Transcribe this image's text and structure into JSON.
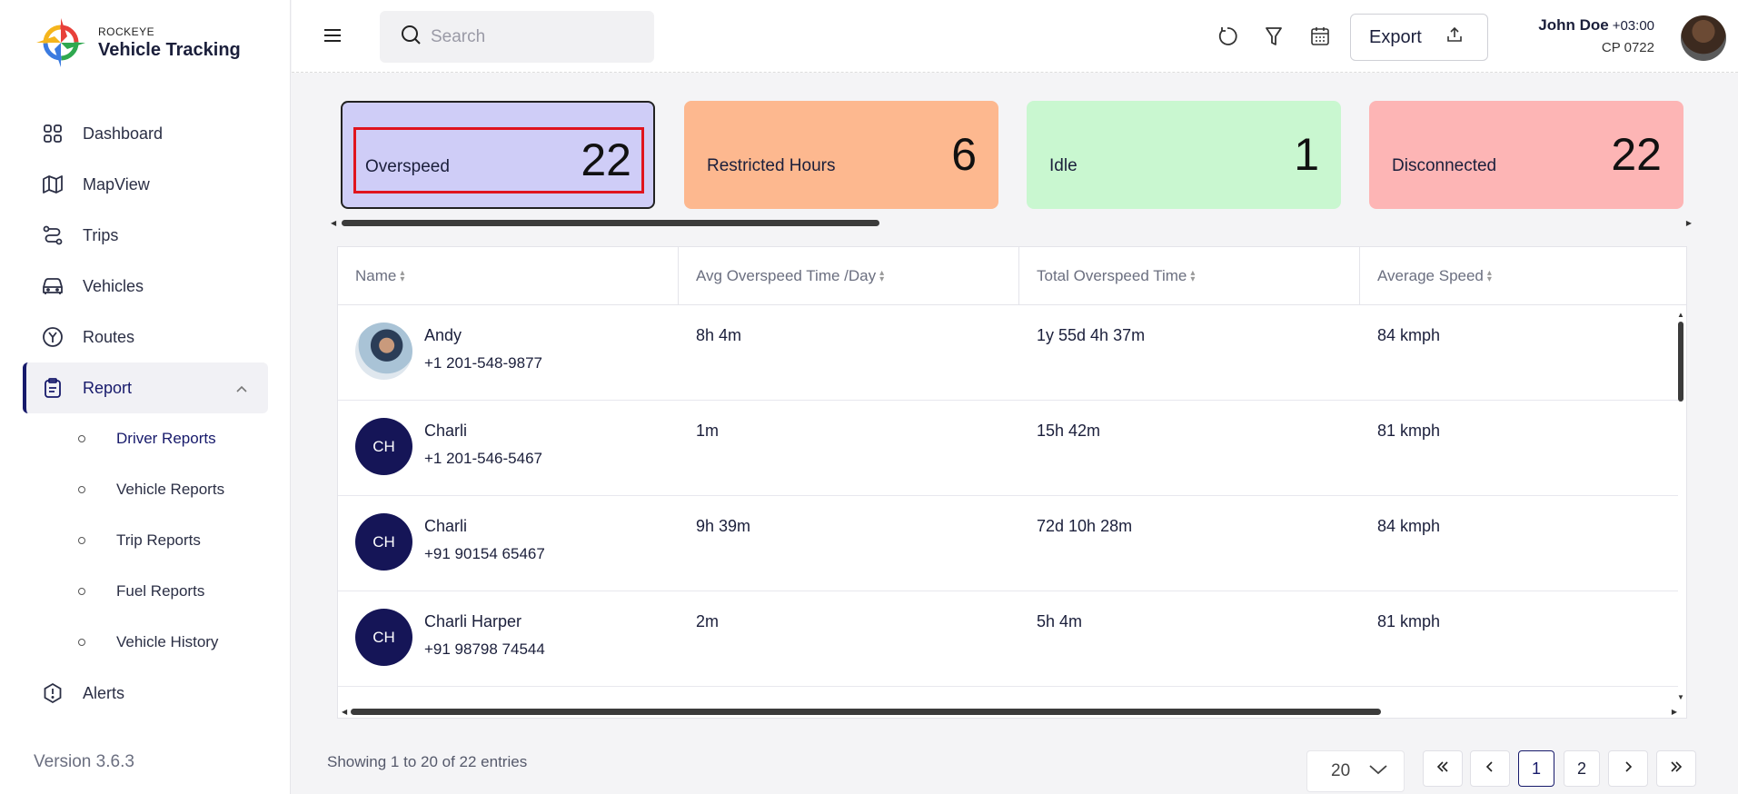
{
  "app": {
    "brand": "ROCKEYE",
    "name": "Vehicle Tracking",
    "version": "Version 3.6.3"
  },
  "sidebar": {
    "items": [
      {
        "label": "Dashboard",
        "icon": "dashboard-grid-icon"
      },
      {
        "label": "MapView",
        "icon": "map-icon"
      },
      {
        "label": "Trips",
        "icon": "route-path-icon"
      },
      {
        "label": "Vehicles",
        "icon": "car-icon"
      },
      {
        "label": "Routes",
        "icon": "routes-icon"
      },
      {
        "label": "Report",
        "icon": "clipboard-icon",
        "active": true,
        "expanded": true
      },
      {
        "label": "Alerts",
        "icon": "alert-circle-icon"
      }
    ],
    "report_sub": [
      {
        "label": "Driver Reports",
        "active": true
      },
      {
        "label": "Vehicle Reports"
      },
      {
        "label": "Trip Reports"
      },
      {
        "label": "Fuel Reports"
      },
      {
        "label": "Vehicle History"
      }
    ]
  },
  "header": {
    "search_placeholder": "Search",
    "export_label": "Export",
    "user_name": "John Doe",
    "timezone": "+03:00",
    "user_code": "CP 0722"
  },
  "cards": [
    {
      "label": "Overspeed",
      "value": "22",
      "color": "#cfcdf7",
      "selected": true
    },
    {
      "label": "Restricted Hours",
      "value": "6",
      "color": "#fdb88f"
    },
    {
      "label": "Idle",
      "value": "1",
      "color": "#c9f7d0"
    },
    {
      "label": "Disconnected",
      "value": "22",
      "color": "#fdb5b5"
    }
  ],
  "table": {
    "columns": [
      "Name",
      "Avg Overspeed Time /Day",
      "Total Overspeed Time",
      "Average Speed"
    ],
    "rows": [
      {
        "name": "Andy",
        "phone": "+1 201-548-9877",
        "initials": "",
        "avg": "8h 4m",
        "total": "1y 55d 4h 37m",
        "speed": "84 kmph"
      },
      {
        "name": "Charli",
        "phone": "+1 201-546-5467",
        "initials": "CH",
        "avg": "1m",
        "total": "15h 42m",
        "speed": "81 kmph"
      },
      {
        "name": "Charli",
        "phone": "+91 90154 65467",
        "initials": "CH",
        "avg": "9h 39m",
        "total": "72d 10h 28m",
        "speed": "84 kmph"
      },
      {
        "name": "Charli Harper",
        "phone": "+91 98798 74544",
        "initials": "CH",
        "avg": "2m",
        "total": "5h 4m",
        "speed": "81 kmph"
      }
    ]
  },
  "footer": {
    "showing": "Showing 1 to 20 of 22 entries",
    "page_size": "20",
    "pages": [
      "1",
      "2"
    ],
    "current_page": "1"
  }
}
